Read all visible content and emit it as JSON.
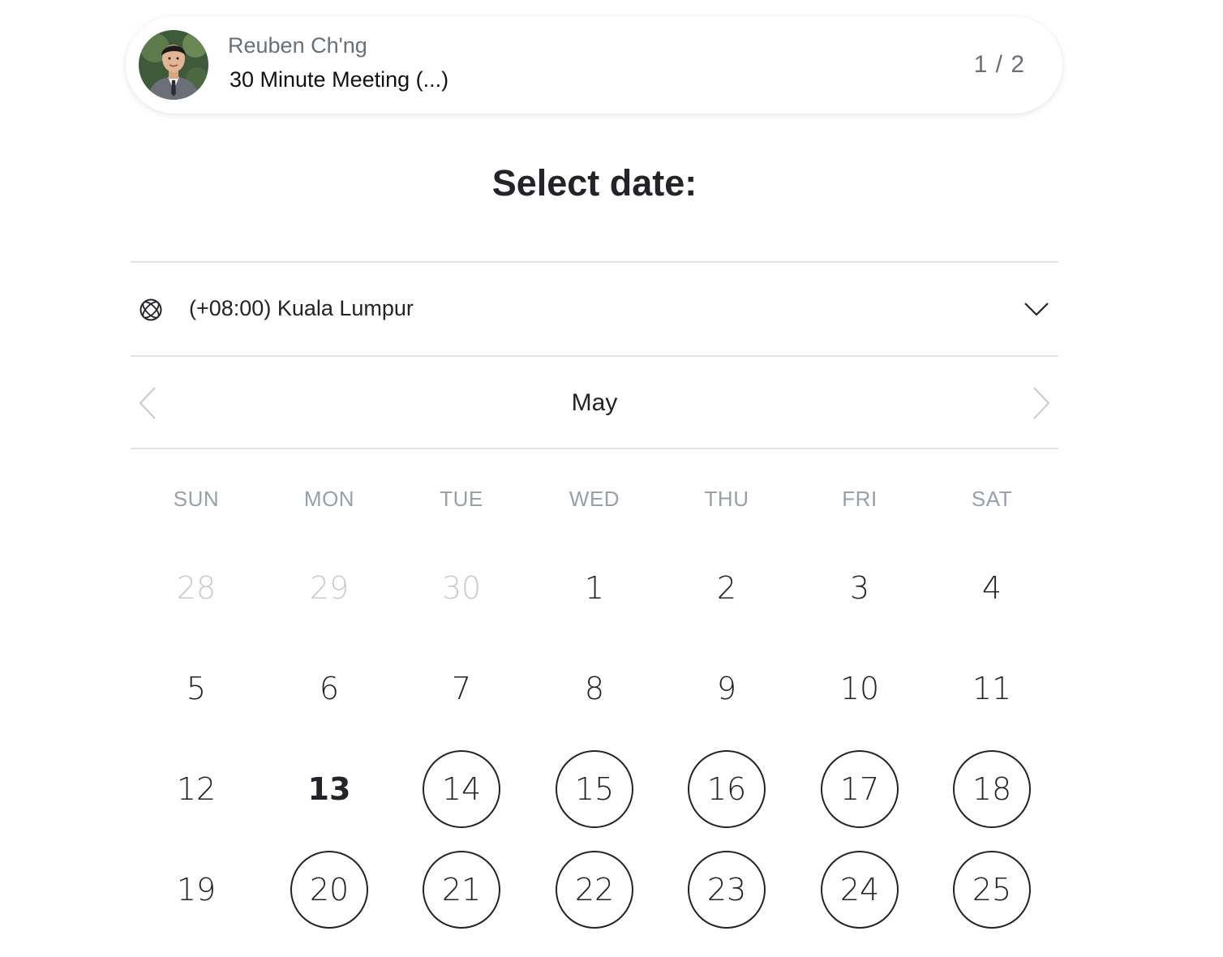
{
  "header": {
    "host_name": "Reuben Ch'ng",
    "event_name": "30 Minute Meeting (...)",
    "step": "1 / 2"
  },
  "title": "Select date:",
  "timezone": {
    "label": "(+08:00) Kuala Lumpur",
    "icon": "globe-icon",
    "dropdown_icon": "chevron-down-icon"
  },
  "calendar": {
    "month": "May",
    "prev_icon": "chevron-left-icon",
    "next_icon": "chevron-right-icon",
    "weekdays": [
      "SUN",
      "MON",
      "TUE",
      "WED",
      "THU",
      "FRI",
      "SAT"
    ],
    "weeks": [
      [
        {
          "label": "28",
          "state": "muted"
        },
        {
          "label": "29",
          "state": "muted"
        },
        {
          "label": "30",
          "state": "muted"
        },
        {
          "label": "1",
          "state": "default"
        },
        {
          "label": "2",
          "state": "default"
        },
        {
          "label": "3",
          "state": "default"
        },
        {
          "label": "4",
          "state": "default"
        }
      ],
      [
        {
          "label": "5",
          "state": "default"
        },
        {
          "label": "6",
          "state": "default"
        },
        {
          "label": "7",
          "state": "default"
        },
        {
          "label": "8",
          "state": "default"
        },
        {
          "label": "9",
          "state": "default"
        },
        {
          "label": "10",
          "state": "default"
        },
        {
          "label": "11",
          "state": "default"
        }
      ],
      [
        {
          "label": "12",
          "state": "default"
        },
        {
          "label": "13",
          "state": "today"
        },
        {
          "label": "14",
          "state": "available"
        },
        {
          "label": "15",
          "state": "available"
        },
        {
          "label": "16",
          "state": "available"
        },
        {
          "label": "17",
          "state": "available"
        },
        {
          "label": "18",
          "state": "available"
        }
      ],
      [
        {
          "label": "19",
          "state": "default"
        },
        {
          "label": "20",
          "state": "available"
        },
        {
          "label": "21",
          "state": "available"
        },
        {
          "label": "22",
          "state": "available"
        },
        {
          "label": "23",
          "state": "available"
        },
        {
          "label": "24",
          "state": "available"
        },
        {
          "label": "25",
          "state": "available"
        }
      ]
    ]
  },
  "colors": {
    "text": "#222428",
    "muted_day": "#c8ccd1",
    "weekday": "#9aa0a8",
    "divider": "#e2e3e5"
  }
}
